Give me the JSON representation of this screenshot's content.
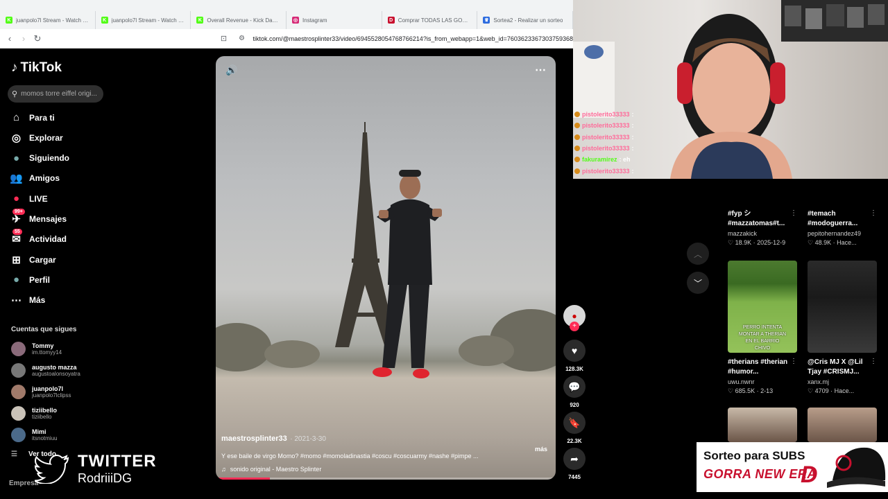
{
  "browser": {
    "tabs": [
      {
        "title": "juanpolo7l Stream - Watch Live",
        "color": "#53fc18",
        "glyph": "K"
      },
      {
        "title": "juanpolo7l Stream - Watch Live",
        "color": "#53fc18",
        "glyph": "K"
      },
      {
        "title": "Overall Revenue - Kick Dashboard",
        "color": "#53fc18",
        "glyph": "K"
      },
      {
        "title": "Instagram",
        "color": "#d62976",
        "glyph": "◎"
      },
      {
        "title": "Comprar TODAS LAS GORRAS",
        "color": "#c8102e",
        "glyph": "D"
      },
      {
        "title": "Sortea2 - Realizar un sorteo",
        "color": "#2d6cdf",
        "glyph": "♛"
      }
    ],
    "url": "tiktok.com/@maestrosplinter33/video/6945528054768766214?is_from_webapp=1&web_id=7603623367303759368"
  },
  "sidebar": {
    "logo": "TikTok",
    "search_placeholder": "momos torre eiffel origi...",
    "nav": [
      {
        "label": "Para ti",
        "icon": "home-icon",
        "glyph": "⌂"
      },
      {
        "label": "Explorar",
        "icon": "compass-icon",
        "glyph": "◎"
      },
      {
        "label": "Siguiendo",
        "icon": "following-avatar-icon",
        "glyph": "●"
      },
      {
        "label": "Amigos",
        "icon": "friends-icon",
        "glyph": "👥"
      },
      {
        "label": "LIVE",
        "icon": "live-icon",
        "glyph": "●"
      },
      {
        "label": "Mensajes",
        "icon": "messages-icon",
        "glyph": "✈",
        "badge": "99+"
      },
      {
        "label": "Actividad",
        "icon": "activity-icon",
        "glyph": "✉",
        "badge": "55"
      },
      {
        "label": "Cargar",
        "icon": "upload-icon",
        "glyph": "⊞"
      },
      {
        "label": "Perfil",
        "icon": "profile-avatar-icon",
        "glyph": "●"
      },
      {
        "label": "Más",
        "icon": "more-icon",
        "glyph": "⋯"
      }
    ],
    "following_title": "Cuentas que sigues",
    "following": [
      {
        "name": "Tommy",
        "handle": "im.ttomyy14"
      },
      {
        "name": "augusto mazza",
        "handle": "augustoalonsoyatra"
      },
      {
        "name": "juanpolo7l",
        "handle": "juanpolo7lclipss"
      },
      {
        "name": "tiziibello",
        "handle": "tiziibello"
      },
      {
        "name": "Mimi",
        "handle": "itsnotmiuu"
      }
    ],
    "see_all": "Ver todo",
    "footer": "Empresa"
  },
  "video": {
    "author": "maestrosplinter33",
    "date": "· 2021-3-30",
    "description": "Y ese baile de virgo Momo? #momo #momoladinastia #coscu #coscuarmy #nashe #pimpe ...",
    "more": "más",
    "sound": "sonido original - Maestro Splinter",
    "progress": 0.16,
    "likes": "128.3K",
    "comments": "920",
    "saves": "22.3K",
    "shares": "7445"
  },
  "chat": [
    {
      "user": "pistolerito33333",
      "color": "#ff6b9a"
    },
    {
      "user": "pistolerito33333",
      "color": "#ff6b9a"
    },
    {
      "user": "pistolerito33333",
      "color": "#ff6b9a"
    },
    {
      "user": "pistolerito33333",
      "color": "#ff6b9a"
    },
    {
      "user": "fakuramirez",
      "color": "#53fc18",
      "message": ": eh"
    },
    {
      "user": "pistolerito33333",
      "color": "#ff6b9a"
    }
  ],
  "feed": [
    {
      "title": "#fyp シ #mazzatomas#t...",
      "user": "mazzakick",
      "likes": "18.9K",
      "date": "2025-12-9"
    },
    {
      "title": "#temach #modoguerra...",
      "user": "pepitohernandez49",
      "likes": "48.9K",
      "date": "Hace..."
    },
    {
      "title": "#therians #therian #humor...",
      "user": "uwu.nwnr",
      "likes": "685.5K",
      "date": "2-13",
      "thumb_text": "PERRO INTENTA MONTAR A THERIAN EN EL BARRIO CHIVO"
    },
    {
      "title": "@Cris MJ X @Lil Tjay #CRISMJ...",
      "user": "xanx.mj",
      "likes": "4709",
      "date": "Hace..."
    }
  ],
  "overlay": {
    "twitter_label": "TWITTER",
    "twitter_handle": "RodriiiDG",
    "sorteo_line1": "Sorteo para SUBS",
    "sorteo_line2": "GORRA NEW ERA"
  }
}
